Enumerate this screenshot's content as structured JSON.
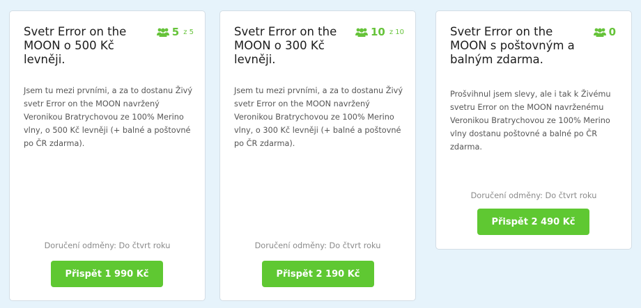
{
  "rewards": [
    {
      "title": "Svetr Error on the MOON o 500 Kč levněji.",
      "count": "5",
      "count_of": "z 5",
      "description": "Jsem tu mezi prvními, a za to dostanu Živý svetr Error on the MOON navržený Veronikou Bratrychovou ze 100% Merino vlny, o 500 Kč levněji (+ balné a poštovné po ČR zdarma).",
      "delivery": "Doručení odměny: Do čtvrt roku",
      "button": "Přispět 1 990 Kč"
    },
    {
      "title": "Svetr Error on the MOON o 300 Kč levněji.",
      "count": "10",
      "count_of": "z 10",
      "description": "Jsem tu mezi prvními, a za to dostanu Živý svetr Error on the MOON navržený Veronikou Bratrychovou ze 100% Merino vlny, o 300 Kč levněji (+ balné a poštovné po ČR zdarma).",
      "delivery": "Doručení odměny: Do čtvrt roku",
      "button": "Přispět 2 190 Kč"
    },
    {
      "title": "Svetr Error on the MOON s poštovným a balným zdarma.",
      "count": "0",
      "count_of": "",
      "description": "Prošvihnul jsem slevy, ale i tak k Živému svetru Error on the MOON navrženému Veronikou Bratrychovou ze 100% Merino vlny dostanu poštovné a balné po ČR zdarma.",
      "delivery": "Doručení odměny: Do čtvrt roku",
      "button": "Přispět 2 490 Kč"
    }
  ],
  "icons": {
    "backers": "users-icon"
  },
  "colors": {
    "accent": "#5fc832",
    "background": "#e6f3fb"
  }
}
